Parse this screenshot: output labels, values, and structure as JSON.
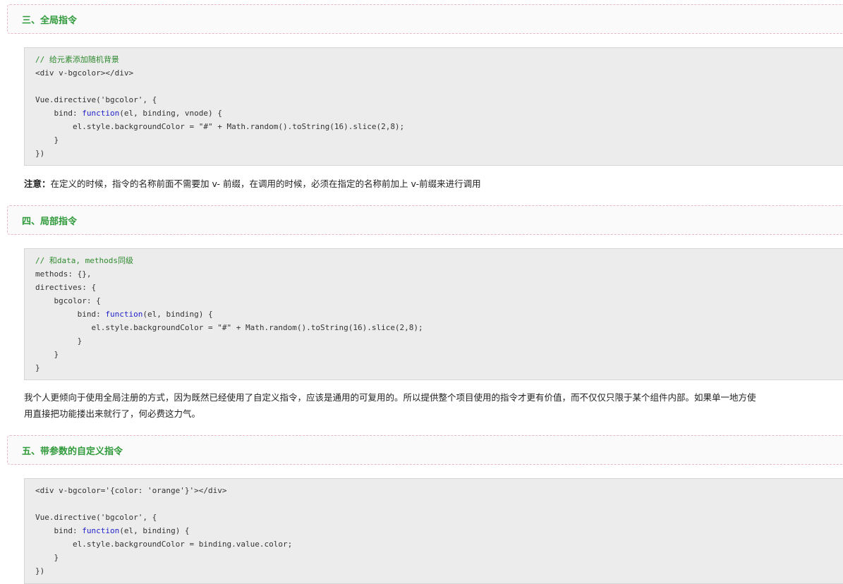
{
  "section3": {
    "heading": "三、全局指令",
    "code": [
      {
        "segments": [
          {
            "text": "// 给元素添加随机背景",
            "style": "cmt"
          }
        ]
      },
      {
        "segments": [
          {
            "text": "<div v-bgcolor></div>",
            "style": ""
          }
        ]
      },
      {
        "segments": [
          {
            "text": "",
            "style": ""
          }
        ]
      },
      {
        "segments": [
          {
            "text": "Vue.directive('bgcolor', {",
            "style": ""
          }
        ]
      },
      {
        "segments": [
          {
            "text": "    bind: ",
            "style": ""
          },
          {
            "text": "function",
            "style": "kw"
          },
          {
            "text": "(el, binding, vnode) {",
            "style": ""
          }
        ]
      },
      {
        "segments": [
          {
            "text": "        el.style.backgroundColor = \"#\" + Math.random().toString(16).slice(2,8);",
            "style": ""
          }
        ]
      },
      {
        "segments": [
          {
            "text": "    }",
            "style": ""
          }
        ]
      },
      {
        "segments": [
          {
            "text": "})",
            "style": ""
          }
        ]
      }
    ],
    "note_label": "注意：",
    "note_text": "在定义的时候，指令的名称前面不需要加 v- 前缀，在调用的时候，必须在指定的名称前加上 v-前缀来进行调用"
  },
  "section4": {
    "heading": "四、局部指令",
    "code": [
      {
        "segments": [
          {
            "text": "// 和data, methods同级",
            "style": "cmt"
          }
        ]
      },
      {
        "segments": [
          {
            "text": "methods: {},",
            "style": ""
          }
        ]
      },
      {
        "segments": [
          {
            "text": "directives: {",
            "style": ""
          }
        ]
      },
      {
        "segments": [
          {
            "text": "    bgcolor: {",
            "style": ""
          }
        ]
      },
      {
        "segments": [
          {
            "text": "         bind: ",
            "style": ""
          },
          {
            "text": "function",
            "style": "kw"
          },
          {
            "text": "(el, binding) {",
            "style": ""
          }
        ]
      },
      {
        "segments": [
          {
            "text": "            el.style.backgroundColor = \"#\" + Math.random().toString(16).slice(2,8);",
            "style": ""
          }
        ]
      },
      {
        "segments": [
          {
            "text": "         }",
            "style": ""
          }
        ]
      },
      {
        "segments": [
          {
            "text": "    }",
            "style": ""
          }
        ]
      },
      {
        "segments": [
          {
            "text": "}",
            "style": ""
          }
        ]
      }
    ],
    "para_line1": "我个人更倾向于使用全局注册的方式，因为既然已经使用了自定义指令，应该是通用的可复用的。所以提供整个项目使用的指令才更有价值，而不仅仅只限于某个组件内部。如果单一地方使",
    "para_line2": "用直接把功能搂出来就行了，何必费这力气。"
  },
  "section5": {
    "heading": "五、带参数的自定义指令",
    "code": [
      {
        "segments": [
          {
            "text": "<div v-bgcolor='{color: 'orange'}'></div>",
            "style": ""
          }
        ]
      },
      {
        "segments": [
          {
            "text": "",
            "style": ""
          }
        ]
      },
      {
        "segments": [
          {
            "text": "Vue.directive('bgcolor', {",
            "style": ""
          }
        ]
      },
      {
        "segments": [
          {
            "text": "    bind: ",
            "style": ""
          },
          {
            "text": "function",
            "style": "kw"
          },
          {
            "text": "(el, binding) {",
            "style": ""
          }
        ]
      },
      {
        "segments": [
          {
            "text": "        el.style.backgroundColor = binding.value.color;",
            "style": ""
          }
        ]
      },
      {
        "segments": [
          {
            "text": "    }",
            "style": ""
          }
        ]
      },
      {
        "segments": [
          {
            "text": "})",
            "style": ""
          }
        ]
      }
    ]
  },
  "colors": {
    "heading_text": "#2f9a3a",
    "heading_border": "#e9b8c6",
    "code_bg": "#ececec",
    "comment": "#2f8a2f",
    "keyword": "#2222cc"
  }
}
